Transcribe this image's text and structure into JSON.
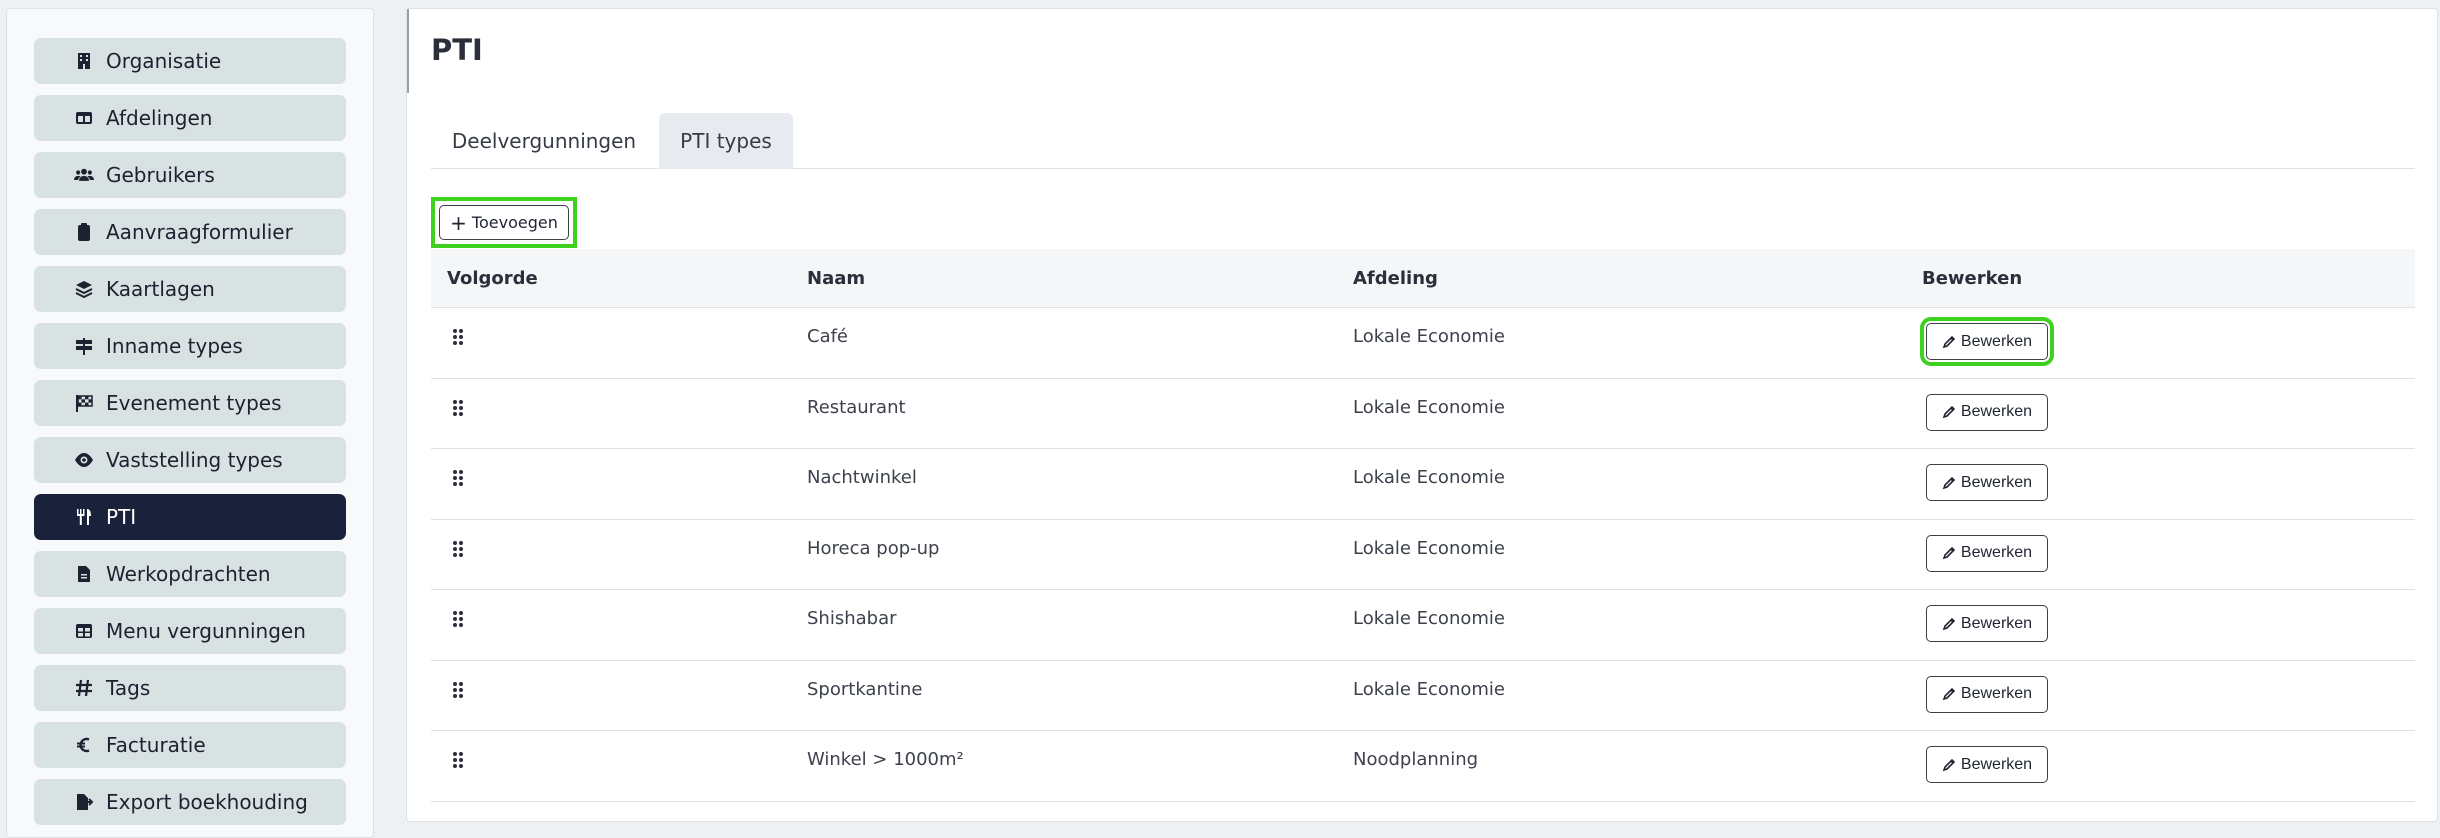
{
  "sidebar": {
    "items": [
      {
        "label": "Organisatie",
        "icon": "building-icon",
        "active": false
      },
      {
        "label": "Afdelingen",
        "icon": "table-columns-icon",
        "active": false
      },
      {
        "label": "Gebruikers",
        "icon": "users-icon",
        "active": false
      },
      {
        "label": "Aanvraagformulier",
        "icon": "clipboard-icon",
        "active": false
      },
      {
        "label": "Kaartlagen",
        "icon": "layers-icon",
        "active": false
      },
      {
        "label": "Inname types",
        "icon": "signs-post-icon",
        "active": false
      },
      {
        "label": "Evenement types",
        "icon": "flag-checkered-icon",
        "active": false
      },
      {
        "label": "Vaststelling types",
        "icon": "eye-icon",
        "active": false
      },
      {
        "label": "PTI",
        "icon": "utensils-icon",
        "active": true
      },
      {
        "label": "Werkopdrachten",
        "icon": "file-icon",
        "active": false
      },
      {
        "label": "Menu vergunningen",
        "icon": "table-icon",
        "active": false
      },
      {
        "label": "Tags",
        "icon": "hashtag-icon",
        "active": false
      },
      {
        "label": "Facturatie",
        "icon": "euro-icon",
        "active": false
      },
      {
        "label": "Export boekhouding",
        "icon": "file-export-icon",
        "active": false
      }
    ]
  },
  "main": {
    "title": "PTI",
    "tabs": [
      {
        "label": "Deelvergunningen",
        "active": false
      },
      {
        "label": "PTI types",
        "active": true
      }
    ],
    "add_label": "Toevoegen",
    "table": {
      "headers": [
        "Volgorde",
        "Naam",
        "Afdeling",
        "Bewerken"
      ],
      "edit_label": "Bewerken",
      "rows": [
        {
          "naam": "Café",
          "afdeling": "Lokale Economie"
        },
        {
          "naam": "Restaurant",
          "afdeling": "Lokale Economie"
        },
        {
          "naam": "Nachtwinkel",
          "afdeling": "Lokale Economie"
        },
        {
          "naam": "Horeca pop-up",
          "afdeling": "Lokale Economie"
        },
        {
          "naam": "Shishabar",
          "afdeling": "Lokale Economie"
        },
        {
          "naam": "Sportkantine",
          "afdeling": "Lokale Economie"
        },
        {
          "naam": "Winkel > 1000m²",
          "afdeling": "Noodplanning"
        }
      ]
    }
  },
  "colors": {
    "nav_bg": "#d8e2e2",
    "nav_active_bg": "#19223a",
    "highlight": "#3ed120"
  }
}
